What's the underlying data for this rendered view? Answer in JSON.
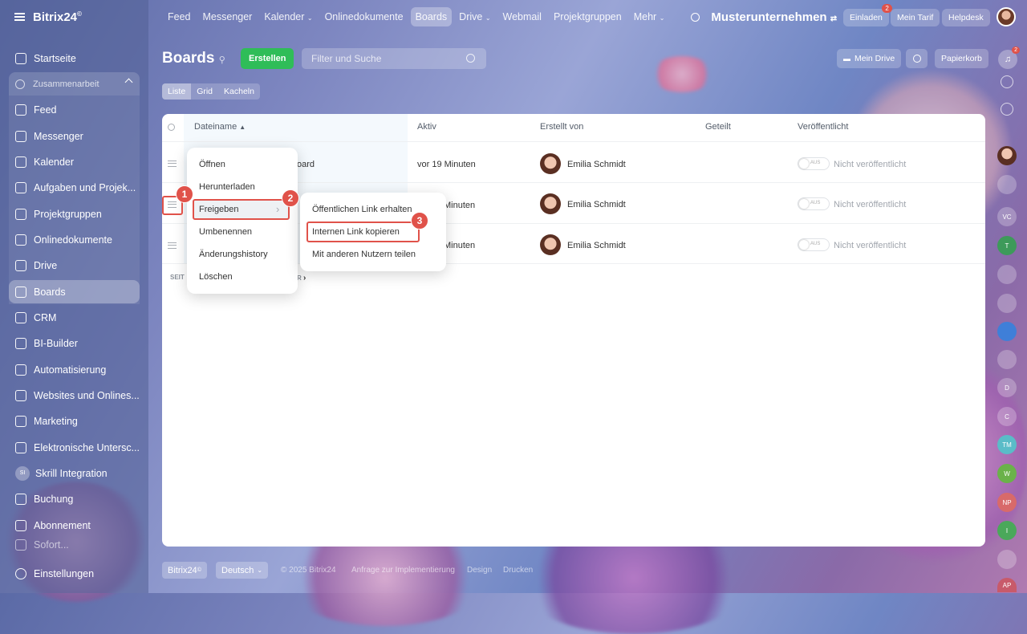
{
  "brand": {
    "name": "Bitrix24",
    "mark": "©"
  },
  "sidebar": {
    "items": [
      {
        "label": "Startseite",
        "icon": "home-icon"
      },
      {
        "label": "Feed",
        "icon": "feed-icon"
      },
      {
        "label": "Messenger",
        "icon": "messenger-icon"
      },
      {
        "label": "Kalender",
        "icon": "calendar-icon"
      },
      {
        "label": "Aufgaben und Projek...",
        "icon": "tasks-icon"
      },
      {
        "label": "Projektgruppen",
        "icon": "groups-icon"
      },
      {
        "label": "Onlinedokumente",
        "icon": "documents-icon"
      },
      {
        "label": "Drive",
        "icon": "drive-icon"
      },
      {
        "label": "Boards",
        "icon": "boards-icon"
      },
      {
        "label": "CRM",
        "icon": "crm-icon"
      },
      {
        "label": "BI-Builder",
        "icon": "bi-icon"
      },
      {
        "label": "Automatisierung",
        "icon": "automation-icon"
      },
      {
        "label": "Websites und Onlines...",
        "icon": "cart-icon"
      },
      {
        "label": "Marketing",
        "icon": "marketing-icon"
      },
      {
        "label": "Elektronische Untersc...",
        "icon": "signature-icon"
      },
      {
        "label": "Skrill Integration",
        "icon": "skrill-icon",
        "badge": "SI"
      },
      {
        "label": "Buchung",
        "icon": "booking-icon"
      },
      {
        "label": "Abonnement",
        "icon": "subscription-icon"
      },
      {
        "label": "Sofort...",
        "icon": "sofort-icon"
      },
      {
        "label": "Einstellungen",
        "icon": "settings-icon"
      }
    ],
    "group": "Zusammenarbeit"
  },
  "topnav": {
    "items": [
      "Feed",
      "Messenger",
      "Kalender",
      "Onlinedokumente",
      "Boards",
      "Drive",
      "Webmail",
      "Projektgruppen",
      "Mehr"
    ],
    "company": "Musterunternehmen",
    "invite": "Einladen",
    "invite_badge": "2",
    "tariff": "Mein Tarif",
    "helpdesk": "Helpdesk"
  },
  "page": {
    "title": "Boards",
    "create": "Erstellen",
    "search_placeholder": "Filter und Suche",
    "views": [
      "Liste",
      "Grid",
      "Kacheln"
    ],
    "my_drive": "Mein Drive",
    "trash": "Papierkorb",
    "notif_badge": "2"
  },
  "table": {
    "headers": [
      "Dateiname",
      "Aktiv",
      "Erstellt von",
      "Geteilt",
      "Veröffentlicht"
    ],
    "rows": [
      {
        "name": "oard",
        "active": "vor 19 Minuten",
        "author": "Emilia Schmidt",
        "published": "Nicht veröffentlicht",
        "toggle": "AUS"
      },
      {
        "name": "",
        "active": "Minuten",
        "author": "Emilia Schmidt",
        "published": "Nicht veröffentlicht",
        "toggle": "AUS"
      },
      {
        "name": "",
        "active": "Minuten",
        "author": "Emilia Schmidt",
        "published": "Nicht veröffentlicht",
        "toggle": "AUS"
      }
    ],
    "pagination_left": "SEIT",
    "pagination_right": "R"
  },
  "context_menu": {
    "items": [
      "Öffnen",
      "Herunterladen",
      "Freigeben",
      "Umbenennen",
      "Änderungshistory",
      "Löschen"
    ]
  },
  "submenu": {
    "items": [
      "Öffentlichen Link erhalten",
      "Internen Link kopieren",
      "Mit anderen Nutzern teilen"
    ]
  },
  "steps": [
    "1",
    "2",
    "3"
  ],
  "footer": {
    "brand": "Bitrix24",
    "lang": "Deutsch",
    "copyright": "© 2025 Bitrix24",
    "impl": "Anfrage zur Implementierung",
    "design": "Design",
    "print": "Drucken"
  },
  "rightbar": [
    "VC",
    "T",
    "D",
    "C",
    "TM",
    "W",
    "NP",
    "I",
    "AP"
  ],
  "colors": {
    "accent": "#2fbd58",
    "highlight": "#e0524a"
  }
}
